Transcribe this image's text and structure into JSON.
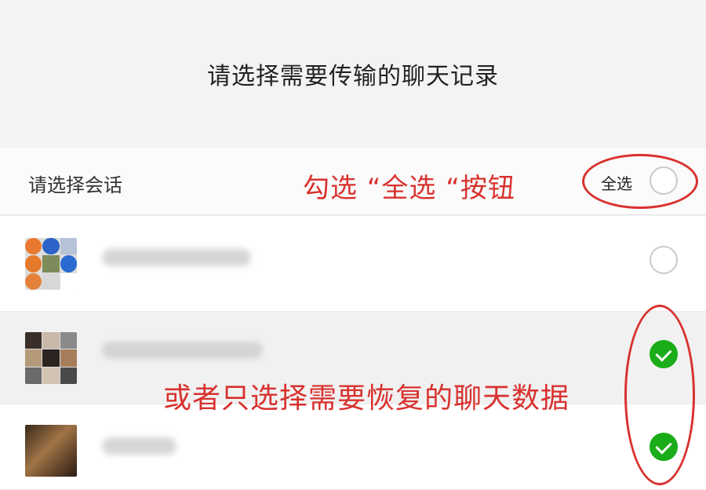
{
  "header": {
    "title": "请选择需要传输的聊天记录"
  },
  "select_bar": {
    "label": "请选择会话",
    "select_all_label": "全选",
    "select_all_checked": false
  },
  "annotations": {
    "select_all_hint": "勾选 “全选 “按钮",
    "partial_hint": "或者只选择需要恢复的聊天数据"
  },
  "conversations": [
    {
      "name": "",
      "checked": false
    },
    {
      "name": "",
      "checked": true
    },
    {
      "name": "",
      "checked": true
    }
  ],
  "colors": {
    "accent_green": "#1aad19",
    "annotation_red": "#d8322f"
  }
}
